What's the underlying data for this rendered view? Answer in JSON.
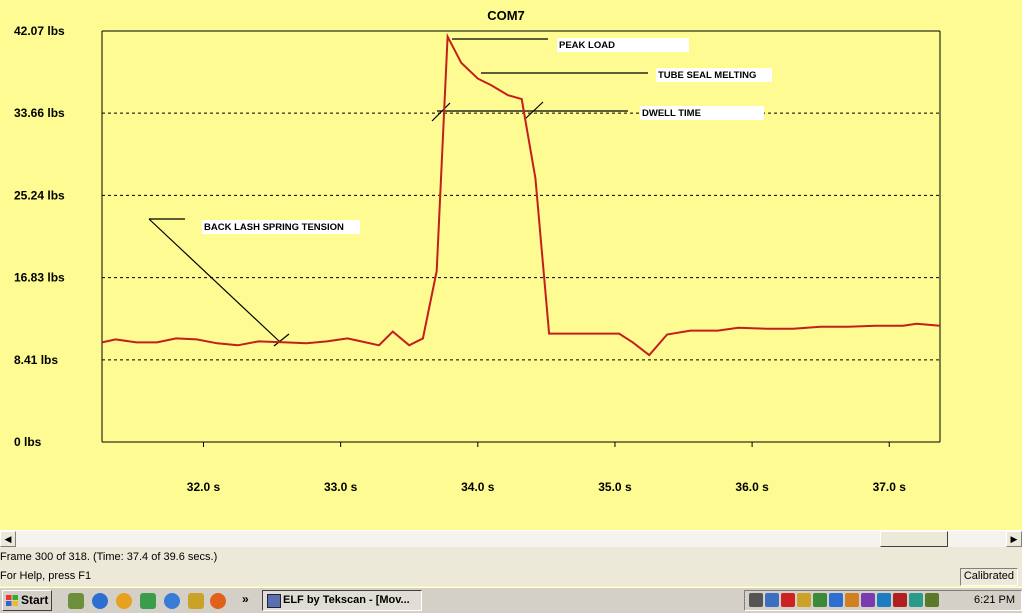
{
  "chart_data": {
    "type": "line",
    "title": "COM7",
    "xlabel": "",
    "ylabel": "",
    "y_ticks": [
      "0 lbs",
      "8.41 lbs",
      "16.83 lbs",
      "25.24 lbs",
      "33.66 lbs",
      "42.07 lbs"
    ],
    "ylim": [
      0,
      42.07
    ],
    "y_tick_values": [
      0,
      8.41,
      16.83,
      25.24,
      33.66,
      42.07
    ],
    "x_ticks": [
      "32.0 s",
      "33.0 s",
      "34.0 s",
      "35.0 s",
      "36.0 s",
      "37.0 s"
    ],
    "x_tick_values": [
      32.0,
      33.0,
      34.0,
      35.0,
      36.0,
      37.0
    ],
    "xlim": [
      31.26,
      37.37
    ],
    "grid": "dashed horizontal",
    "line_color": "#c41e1e",
    "series": [
      {
        "x": [
          31.26,
          31.36,
          31.51,
          31.66,
          31.8,
          31.95,
          32.1,
          32.25,
          32.4,
          32.6,
          32.75,
          32.9,
          33.05,
          33.15,
          33.28,
          33.38,
          33.5,
          33.6,
          33.7,
          33.78,
          33.88,
          34.0,
          34.1,
          34.22,
          34.32,
          34.42,
          34.52,
          34.63,
          34.75,
          34.9,
          35.03,
          35.13,
          35.25,
          35.38,
          35.55,
          35.75,
          35.9,
          36.1,
          36.3,
          36.5,
          36.7,
          36.9,
          37.1,
          37.2,
          37.37
        ],
        "y": [
          10.2,
          10.5,
          10.2,
          10.2,
          10.6,
          10.5,
          10.1,
          9.9,
          10.3,
          10.2,
          10.1,
          10.3,
          10.6,
          10.3,
          9.9,
          11.3,
          9.9,
          10.6,
          17.5,
          41.5,
          38.8,
          37.2,
          36.5,
          35.5,
          35.1,
          27.0,
          11.1,
          11.1,
          11.1,
          11.1,
          11.1,
          10.2,
          8.9,
          11.0,
          11.4,
          11.4,
          11.7,
          11.6,
          11.6,
          11.8,
          11.8,
          11.9,
          11.9,
          12.1,
          11.9
        ]
      }
    ],
    "annotations": [
      "PEAK LOAD",
      "TUBE SEAL MELTING",
      "DWELL TIME",
      "BACK LASH SPRING TENSION"
    ]
  },
  "scrollbar": {
    "left_arrow": "◀",
    "right_arrow": "▶"
  },
  "status": {
    "frame": "Frame 300 of 318. (Time: 37.4 of 39.6 secs.)",
    "help": "For Help, press F1",
    "calibrated": "Calibrated"
  },
  "taskbar": {
    "start_label": "Start",
    "chevron": "»",
    "task_label": "ELF by Tekscan - [Mov...",
    "clock": "6:21 PM"
  },
  "colors": {
    "background": "#fdfb92",
    "line": "#c41e1e",
    "taskbar": "#d4d0c8"
  }
}
